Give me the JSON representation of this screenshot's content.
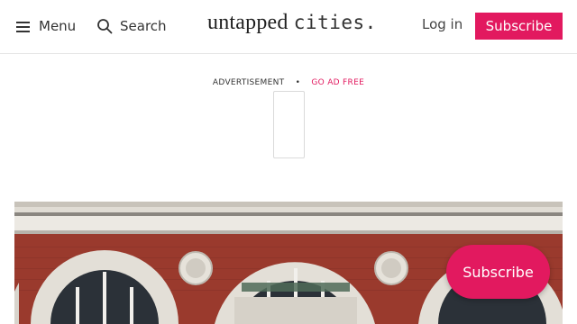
{
  "header": {
    "menu_label": "Menu",
    "search_label": "Search",
    "logo_part1": "untapped",
    "logo_part2": "cities.",
    "login_label": "Log in",
    "subscribe_label": "Subscribe"
  },
  "ad": {
    "label": "ADVERTISEMENT",
    "separator": "•",
    "go_ad_free": "GO AD FREE"
  },
  "floating": {
    "subscribe_label": "Subscribe"
  },
  "icons": {
    "menu": "hamburger-icon",
    "search": "search-icon"
  },
  "colors": {
    "accent": "#e2195f",
    "brick": "#9a3a2d",
    "stone": "#d8d4cc"
  }
}
